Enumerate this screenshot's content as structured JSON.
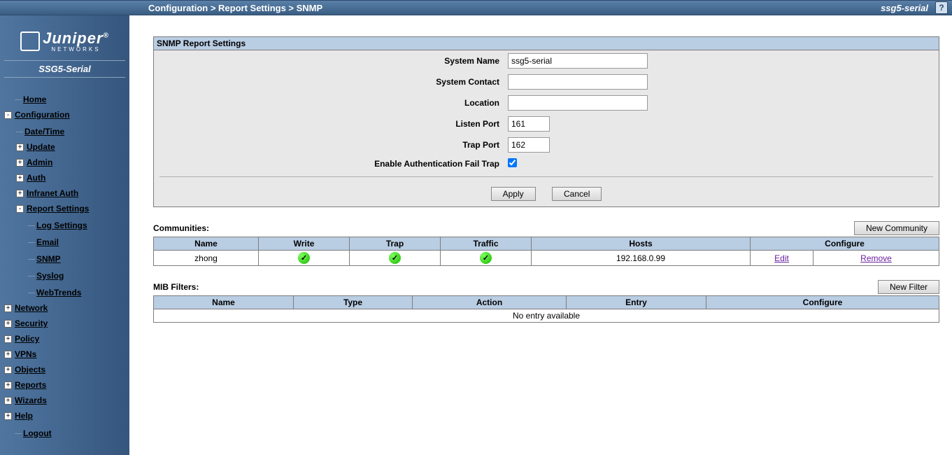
{
  "topbar": {
    "breadcrumb": "Configuration > Report Settings > SNMP",
    "device": "ssg5-serial",
    "help": "?"
  },
  "sidebar": {
    "brand": "Juniper",
    "brand_sub": "NETWORKS",
    "device": "SSG5-Serial",
    "items": {
      "home": "Home",
      "configuration": "Configuration",
      "datetime": "Date/Time",
      "update": "Update",
      "admin": "Admin",
      "auth": "Auth",
      "infranet": "Infranet Auth",
      "report_settings": "Report Settings",
      "log_settings": "Log Settings",
      "email": "Email",
      "snmp": "SNMP",
      "syslog": "Syslog",
      "webtrends": "WebTrends",
      "network": "Network",
      "security": "Security",
      "policy": "Policy",
      "vpns": "VPNs",
      "objects": "Objects",
      "reports": "Reports",
      "wizards": "Wizards",
      "help": "Help",
      "logout": "Logout"
    }
  },
  "panel": {
    "title": "SNMP Report Settings",
    "labels": {
      "system_name": "System Name",
      "system_contact": "System Contact",
      "location": "Location",
      "listen_port": "Listen Port",
      "trap_port": "Trap Port",
      "auth_fail": "Enable Authentication Fail Trap"
    },
    "values": {
      "system_name": "ssg5-serial",
      "system_contact": "",
      "location": "",
      "listen_port": "161",
      "trap_port": "162",
      "auth_fail_checked": true
    },
    "buttons": {
      "apply": "Apply",
      "cancel": "Cancel"
    }
  },
  "communities": {
    "title": "Communities:",
    "new_btn": "New Community",
    "headers": {
      "name": "Name",
      "write": "Write",
      "trap": "Trap",
      "traffic": "Traffic",
      "hosts": "Hosts",
      "configure": "Configure"
    },
    "rows": [
      {
        "name": "zhong",
        "write": true,
        "trap": true,
        "traffic": true,
        "hosts": "192.168.0.99",
        "edit": "Edit",
        "remove": "Remove"
      }
    ]
  },
  "mib": {
    "title": "MIB Filters:",
    "new_btn": "New Filter",
    "headers": {
      "name": "Name",
      "type": "Type",
      "action": "Action",
      "entry": "Entry",
      "configure": "Configure"
    },
    "empty": "No entry available"
  }
}
